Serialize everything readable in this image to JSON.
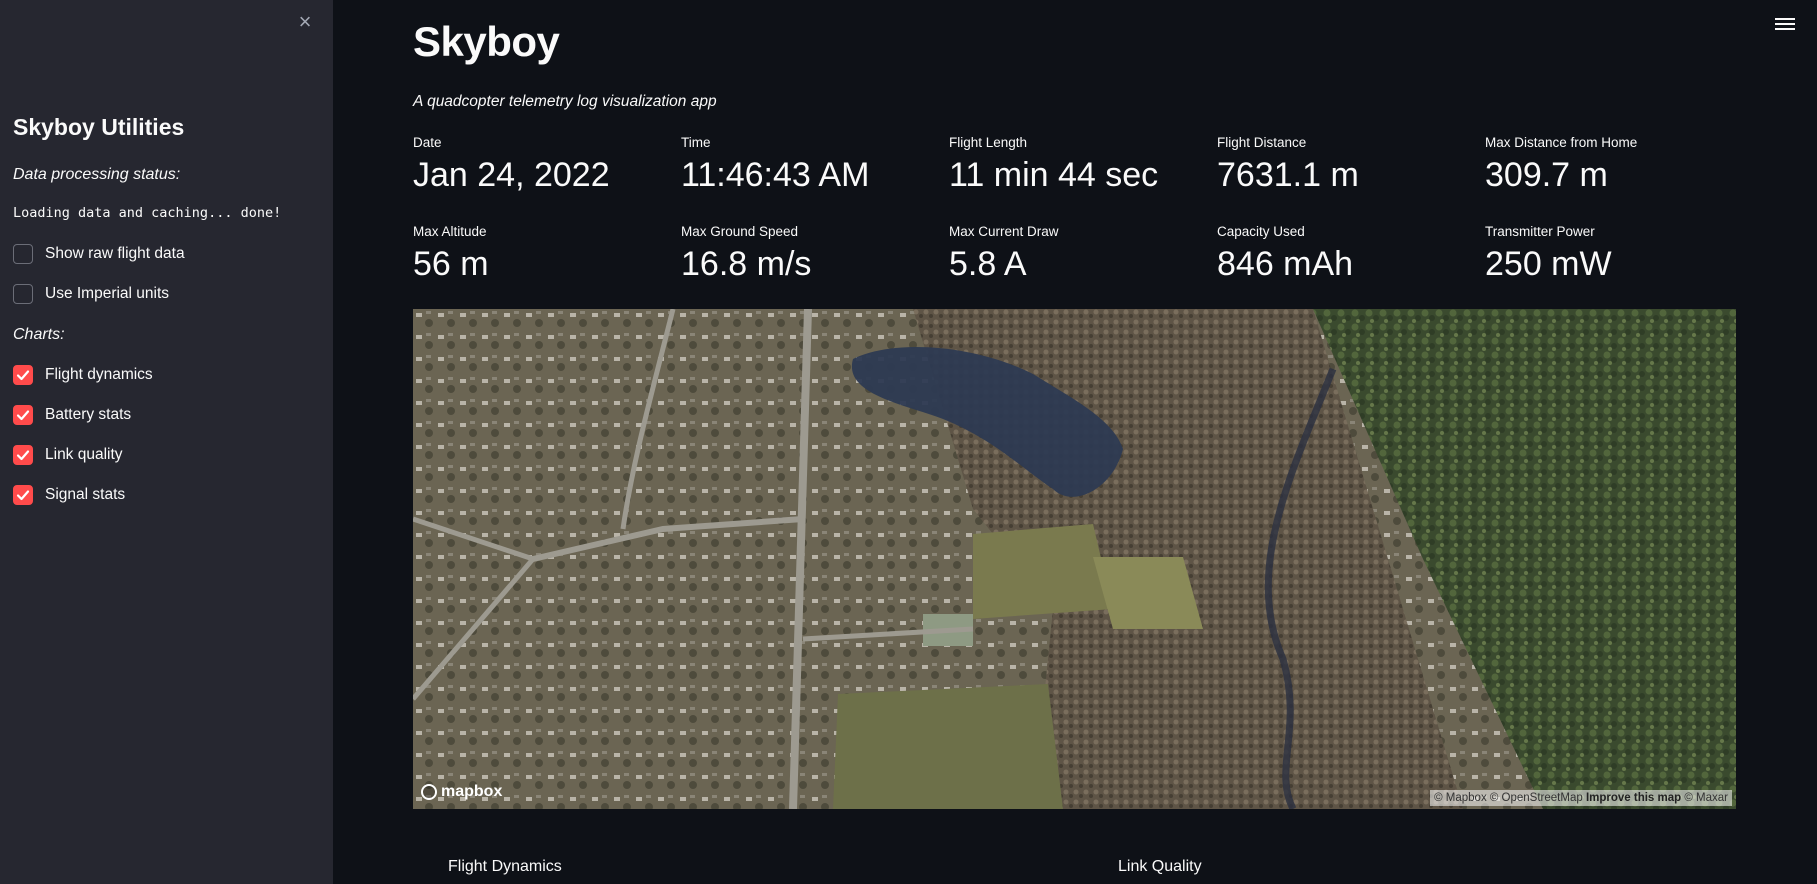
{
  "sidebar": {
    "close_icon": "×",
    "title": "Skyboy Utilities",
    "status_label": "Data processing status:",
    "status_text": "Loading data and caching... done!",
    "options": [
      {
        "label": "Show raw flight data",
        "checked": false
      },
      {
        "label": "Use Imperial units",
        "checked": false
      }
    ],
    "charts_label": "Charts:",
    "charts": [
      {
        "label": "Flight dynamics",
        "checked": true
      },
      {
        "label": "Battery stats",
        "checked": true
      },
      {
        "label": "Link quality",
        "checked": true
      },
      {
        "label": "Signal stats",
        "checked": true
      }
    ]
  },
  "header": {
    "title": "Skyboy",
    "subtitle": "A quadcopter telemetry log visualization app",
    "menu_icon": "hamburger-menu-icon"
  },
  "metrics": [
    {
      "label": "Date",
      "value": "Jan 24, 2022"
    },
    {
      "label": "Time",
      "value": "11:46:43 AM"
    },
    {
      "label": "Flight Length",
      "value": "11 min 44 sec"
    },
    {
      "label": "Flight Distance",
      "value": "7631.1 m"
    },
    {
      "label": "Max Distance from Home",
      "value": "309.7 m"
    },
    {
      "label": "Max Altitude",
      "value": "56 m"
    },
    {
      "label": "Max Ground Speed",
      "value": "16.8 m/s"
    },
    {
      "label": "Max Current Draw",
      "value": "5.8 A"
    },
    {
      "label": "Capacity Used",
      "value": "846 mAh"
    },
    {
      "label": "Transmitter Power",
      "value": "250 mW"
    }
  ],
  "map": {
    "logo": "mapbox",
    "attribution_a": "© Mapbox © OpenStreetMap",
    "attribution_link": "Improve this map",
    "attribution_b": "© Maxar"
  },
  "sections": {
    "left": "Flight Dynamics",
    "right": "Link Quality"
  },
  "colors": {
    "accent": "#ff4b4b",
    "background": "#0e1117",
    "sidebar": "#262730"
  }
}
